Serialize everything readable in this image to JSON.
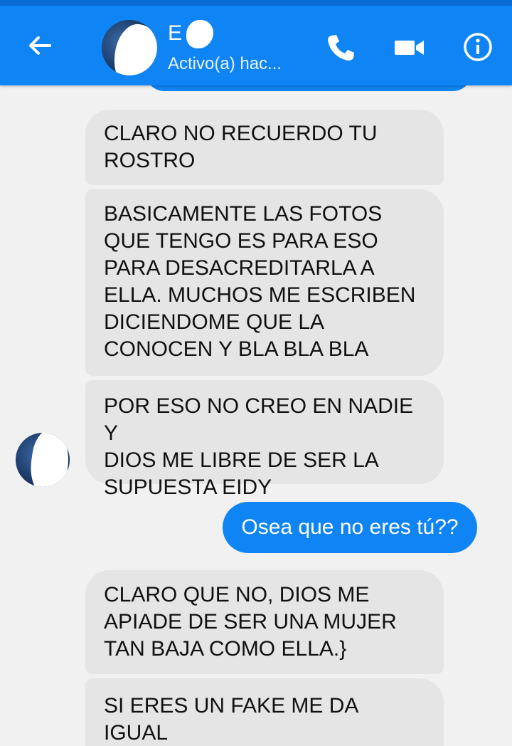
{
  "header": {
    "contact_name": "E",
    "status": "Activo(a) hac..."
  },
  "icons": {
    "back": "arrow-left-icon",
    "call": "phone-icon",
    "video": "video-camera-icon",
    "info": "info-icon"
  },
  "messages": [
    {
      "from": "contact",
      "text": "CLARO NO RECUERDO TU\nROSTRO"
    },
    {
      "from": "contact",
      "text": "BASICAMENTE LAS FOTOS\nQUE TENGO ES PARA ESO\nPARA DESACREDITARLA A\nELLA. MUCHOS ME ESCRIBEN\nDICIENDOME QUE LA\nCONOCEN Y BLA BLA BLA"
    },
    {
      "from": "contact",
      "text": "POR ESO NO CREO EN NADIE Y\nDIOS ME LIBRE DE SER LA\nSUPUESTA EIDY"
    },
    {
      "from": "me",
      "text": "Osea que no eres tú??"
    },
    {
      "from": "contact",
      "text": "CLARO QUE NO, DIOS ME\nAPIADE DE SER UNA MUJER\nTAN BAJA COMO ELLA.}"
    },
    {
      "from": "contact",
      "text": "SI ERES UN FAKE ME DA IGUAL\nTODOS SABEN QUIEN ES ELLA"
    }
  ],
  "colors": {
    "header_bg": "#0f84f4",
    "outgoing_bubble": "#0f84f4",
    "incoming_bubble": "#e5e5e5",
    "background": "#f1f1f1"
  }
}
